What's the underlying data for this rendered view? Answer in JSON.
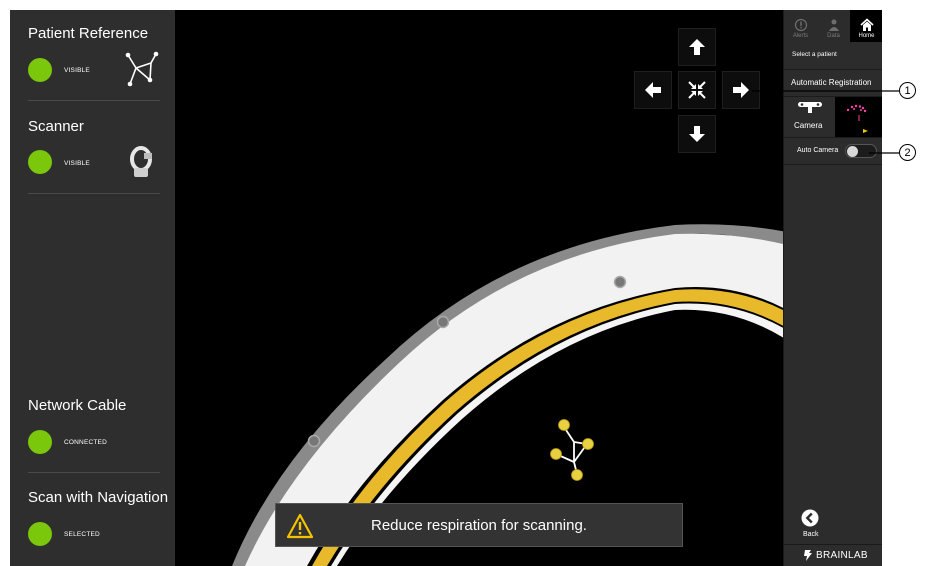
{
  "left_panel": {
    "items": [
      {
        "title": "Patient Reference",
        "status": "VISIBLE",
        "status_color": "#7ac70c",
        "icon": "patient-reference-array-icon"
      },
      {
        "title": "Scanner",
        "status": "VISIBLE",
        "status_color": "#7ac70c",
        "icon": "scanner-icon"
      },
      {
        "title": "Network Cable",
        "status": "CONNECTED",
        "status_color": "#7ac70c"
      },
      {
        "title": "Scan with Navigation",
        "status": "SELECTED",
        "status_color": "#7ac70c"
      }
    ]
  },
  "viewport": {
    "nav_buttons": [
      "arrow-up-icon",
      "arrow-left-icon",
      "center-view-icon",
      "arrow-right-icon",
      "arrow-down-icon"
    ],
    "message": "Reduce respiration for scanning.",
    "ring_stripe_color": "#e8b92a"
  },
  "right_panel": {
    "tabs": [
      {
        "label": "Alerts",
        "icon": "alert-icon",
        "active": false
      },
      {
        "label": "Data",
        "icon": "data-icon",
        "active": false
      },
      {
        "label": "Home",
        "icon": "home-icon",
        "active": true
      }
    ],
    "select_patient": "Select a patient",
    "automatic_registration": "Automatic Registration",
    "camera_label": "Camera",
    "auto_camera_label": "Auto Camera",
    "back_label": "Back",
    "brand": "BRAINLAB"
  },
  "callouts": [
    "1",
    "2"
  ]
}
